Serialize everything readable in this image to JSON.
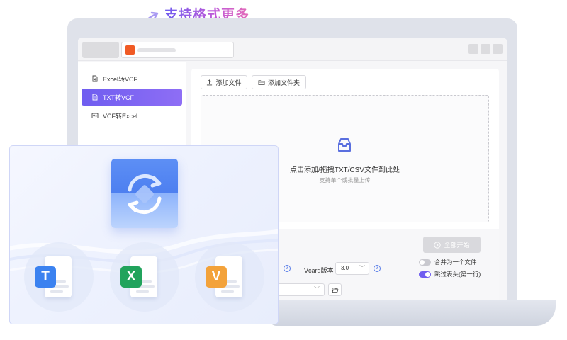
{
  "promo": {
    "headline": "支持格式更多"
  },
  "sidebar": {
    "items": [
      {
        "label": "Excel转VCF",
        "icon": "excel-file-icon"
      },
      {
        "label": "TXT转VCF",
        "icon": "txt-file-icon",
        "active": true
      },
      {
        "label": "VCF转Excel",
        "icon": "vcf-file-icon"
      }
    ]
  },
  "toolbar": {
    "add_file_label": "添加文件",
    "add_folder_label": "添加文件夹"
  },
  "dropzone": {
    "title": "点击添加/拖拽TXT/CSV文件到此处",
    "subtitle": "支持单个或批量上传"
  },
  "settings": {
    "start_all_label": "全部开始",
    "vcard_version_label": "Vcard版本",
    "vcard_version_value": "3.0",
    "merge_label": "合并为一个文件",
    "merge_enabled": false,
    "skip_header_label": "跳过表头(第一行)",
    "skip_header_enabled": true
  },
  "formats": [
    {
      "letter": "T",
      "color": "#3b82f0",
      "icon": "txt-format-icon"
    },
    {
      "letter": "X",
      "color": "#21a35c",
      "icon": "excel-format-icon"
    },
    {
      "letter": "V",
      "color": "#f3a23a",
      "icon": "vcf-format-icon"
    }
  ],
  "colors": {
    "accent": "#6f5df0",
    "brand_logo": "#f05a24"
  }
}
